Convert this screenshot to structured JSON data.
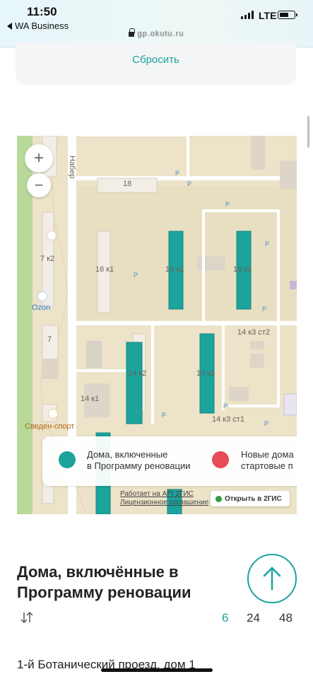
{
  "status_bar": {
    "time": "11:50",
    "back_app": "WA Business",
    "network": "LTE"
  },
  "browser": {
    "url_text": "gp.okutu.ru"
  },
  "filters": {
    "reset_label": "Сбросить"
  },
  "map": {
    "zoom_in": "+",
    "zoom_out": "−",
    "street_label": "Набер",
    "building_labels": {
      "b18": "18",
      "b16k1": "16 к1",
      "b16k2": "16 к2",
      "b16k3": "16 к3",
      "b7k2": "7 к2",
      "b7": "7",
      "b14k2": "14 к2",
      "b14k3": "14 к3",
      "b14k1": "14 к1",
      "b14k3st2": "14 к3 ст2",
      "b14k3st1": "14 к3 ст1"
    },
    "poi": {
      "ozon": "Ozon",
      "sport": "Сведен-спорт"
    },
    "legend": {
      "included_label_line1": "Дома, включенные",
      "included_label_line2": "в Программу реновации",
      "new_label_line1": "Новые дома",
      "new_label_line2": "стартовые п",
      "included_color": "#1ba39c",
      "new_color": "#e84a57"
    },
    "api_note_line1": "Работает на API 2ГИС",
    "api_note_line2": "Лицензионное соглашение",
    "open_2gis_label": "Открыть в 2ГИС"
  },
  "list_header": {
    "title": "Дома, включённые в Программу реновации",
    "scroll_up_icon": "arrow-up-icon",
    "sort_icon": "sort-arrows-icon",
    "page_sizes": [
      "6",
      "24",
      "48"
    ],
    "selected_page_size": "6",
    "accent_color": "#1ba39c"
  },
  "list": {
    "first_address": "1-й Ботанический проезд, дом 1"
  }
}
